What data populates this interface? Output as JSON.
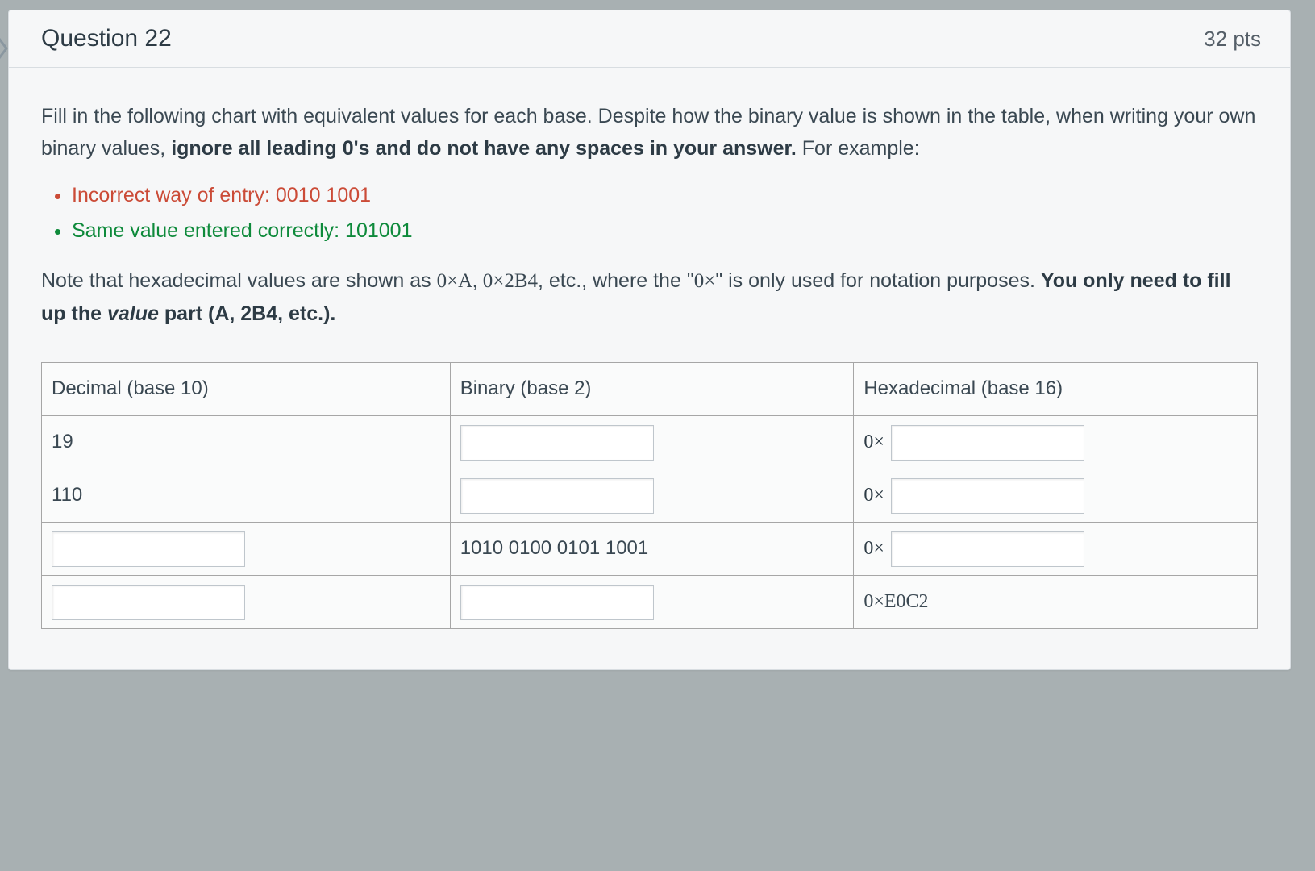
{
  "header": {
    "title": "Question 22",
    "points": "32 pts"
  },
  "instructions": {
    "p1a": "Fill in the following chart with equivalent values for each base. Despite how the binary value is shown in the table, when writing your own binary values, ",
    "p1b": "ignore all leading 0's and do not have any spaces in your answer.",
    "p1c": " For example:",
    "bullet_incorrect": "Incorrect way of entry: 0010 1001",
    "bullet_correct": "Same value entered correctly: 101001",
    "p2a": "Note that hexadecimal values are shown as ",
    "p2b": "0×A, 0×2B4",
    "p2c": ", etc., where the \"",
    "p2d": "0×",
    "p2e": "\" is only used for notation purposes. ",
    "p2f": "You only need to fill up the ",
    "p2g": "value",
    "p2h": " part (A, 2B4, etc.)."
  },
  "table": {
    "headers": {
      "dec": "Decimal (base 10)",
      "bin": "Binary (base 2)",
      "hex": "Hexadecimal (base 16)"
    },
    "hex_prefix": "0×",
    "rows": [
      {
        "dec": "19",
        "bin_input": true,
        "bin_value": "",
        "hex_has_input": true,
        "hex_static": ""
      },
      {
        "dec": "110",
        "bin_input": true,
        "bin_value": "",
        "hex_has_input": true,
        "hex_static": ""
      },
      {
        "dec_input": true,
        "bin_input": false,
        "bin_value": "1010 0100 0101 1001",
        "hex_has_input": true,
        "hex_static": ""
      },
      {
        "dec_input": true,
        "bin_input": true,
        "bin_value": "",
        "hex_has_input": false,
        "hex_static": "0×E0C2"
      }
    ]
  }
}
